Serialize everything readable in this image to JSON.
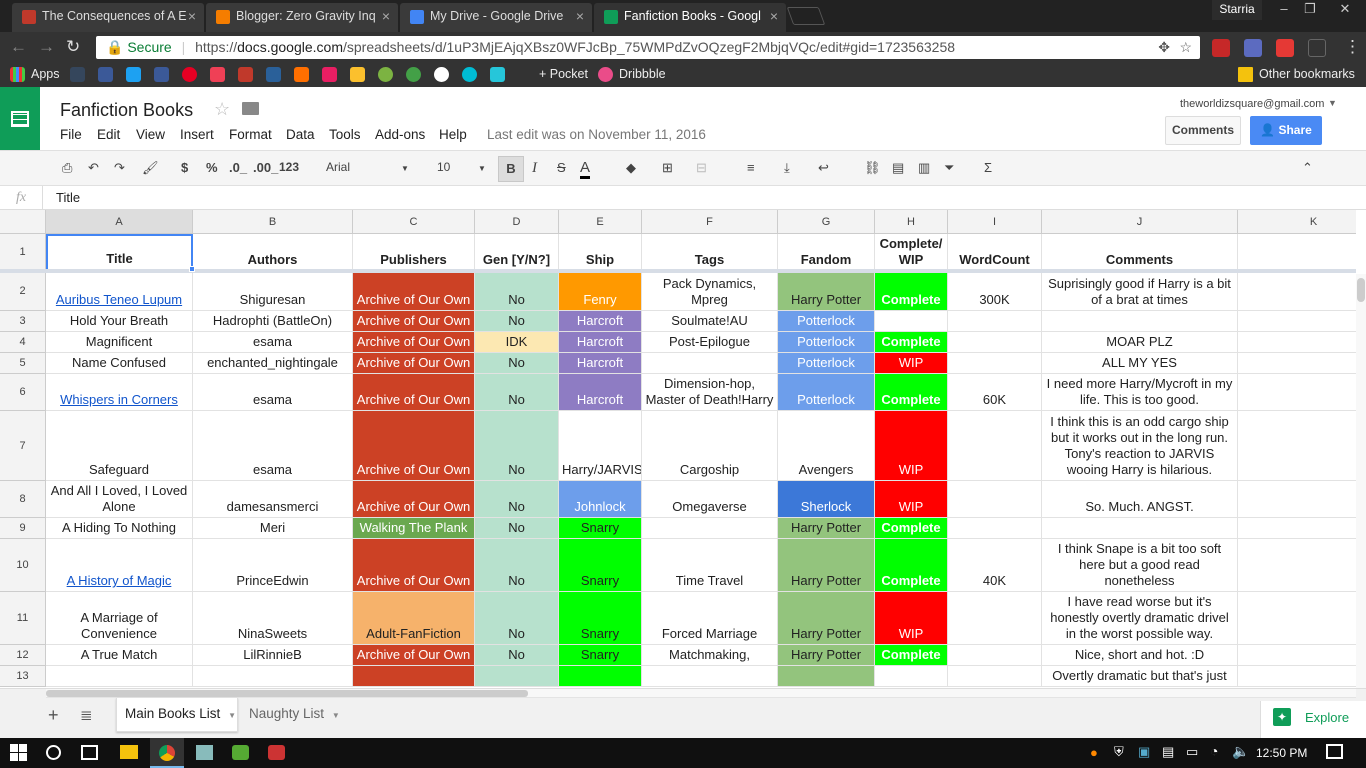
{
  "browser": {
    "tabs": [
      {
        "title": "The Consequences of A E",
        "fav": "#c0392b"
      },
      {
        "title": "Blogger: Zero Gravity Inq",
        "fav": "#f57d00"
      },
      {
        "title": "My Drive - Google Drive",
        "fav": "#4285f4"
      },
      {
        "title": "Fanfiction Books - Googl",
        "fav": "#0f9d58"
      }
    ],
    "profile": "Starria",
    "secure": "Secure",
    "url_prefix": "https://",
    "url_host": "docs.google.com",
    "url_path": "/spreadsheets/d/1uP3MjEAjqXBsz0WFJcBp_75WMPdZvOQzegF2MbjqVQc/edit#gid=1723563258",
    "bookmarks": [
      "Apps",
      "+ Pocket",
      "Dribbble"
    ],
    "other_bookmarks": "Other bookmarks"
  },
  "sheets": {
    "title": "Fanfiction Books",
    "menu": [
      "File",
      "Edit",
      "View",
      "Insert",
      "Format",
      "Data",
      "Tools",
      "Add-ons",
      "Help"
    ],
    "last_edit": "Last edit was on November 11, 2016",
    "account": "theworldizsquare@gmail.com",
    "comments": "Comments",
    "share": "Share",
    "toolbar": {
      "currency": "$",
      "percent": "%",
      "dec0": ".0_",
      "dec00": ".00_",
      "format": "123",
      "font": "Arial",
      "size": "10",
      "bold": "B",
      "italic": "I",
      "strike": "S",
      "color": "A"
    },
    "fx": "fx",
    "formula": "Title",
    "columns": [
      "A",
      "B",
      "C",
      "D",
      "E",
      "F",
      "G",
      "H",
      "I",
      "J",
      "K"
    ],
    "headers": [
      "Title",
      "Authors",
      "Publishers",
      "Gen [Y/N?]",
      "Ship",
      "Tags",
      "Fandom",
      "Complete/ WIP",
      "WordCount",
      "Comments",
      ""
    ],
    "rows": [
      {
        "num": "2",
        "title": "Auribus Teneo Lupum",
        "author": "Shiguresan",
        "pub": "Archive of Our Own",
        "gen": "No",
        "ship": "Fenry",
        "tags": "Pack Dynamics, Mpreg",
        "fandom": "Harry Potter",
        "status": "Complete",
        "wc": "300K",
        "comment": "Suprisingly good if Harry is a bit of a brat at times"
      },
      {
        "num": "3",
        "title": "Hold Your Breath",
        "author": "Hadrophti (BattleOn)",
        "pub": "Archive of Our Own",
        "gen": "No",
        "ship": "Harcroft",
        "tags": "Soulmate!AU",
        "fandom": "Potterlock",
        "status": "",
        "wc": "",
        "comment": ""
      },
      {
        "num": "4",
        "title": "Magnificent",
        "author": "esama",
        "pub": "Archive of Our Own",
        "gen": "IDK",
        "ship": "Harcroft",
        "tags": "Post-Epilogue",
        "fandom": "Potterlock",
        "status": "Complete",
        "wc": "",
        "comment": "MOAR PLZ"
      },
      {
        "num": "5",
        "title": "Name Confused",
        "author": "enchanted_nightingale",
        "pub": "Archive of Our Own",
        "gen": "No",
        "ship": "Harcroft",
        "tags": "",
        "fandom": "Potterlock",
        "status": "WIP",
        "wc": "",
        "comment": "ALL MY YES"
      },
      {
        "num": "6",
        "title": "Whispers in Corners",
        "author": "esama",
        "pub": "Archive of Our Own",
        "gen": "No",
        "ship": "Harcroft",
        "tags": "Dimension-hop, Master of Death!Harry",
        "fandom": "Potterlock",
        "status": "Complete",
        "wc": "60K",
        "comment": "I need more Harry/Mycroft in my life. This is too good."
      },
      {
        "num": "7",
        "title": "Safeguard",
        "author": "esama",
        "pub": "Archive of Our Own",
        "gen": "No",
        "ship": "Harry/JARVIS",
        "tags": "Cargoship",
        "fandom": "Avengers",
        "status": "WIP",
        "wc": "",
        "comment": "I think this is an odd cargo ship but it works out in the long run. Tony's reaction to JARVIS wooing Harry is hilarious."
      },
      {
        "num": "8",
        "title": "And All I Loved, I Loved Alone",
        "author": "damesansmerci",
        "pub": "Archive of Our Own",
        "gen": "No",
        "ship": "Johnlock",
        "tags": "Omegaverse",
        "fandom": "Sherlock",
        "status": "WIP",
        "wc": "",
        "comment": "So. Much. ANGST."
      },
      {
        "num": "9",
        "title": "A Hiding To Nothing",
        "author": "Meri",
        "pub": "Walking The Plank",
        "gen": "No",
        "ship": "Snarry",
        "tags": "",
        "fandom": "Harry Potter",
        "status": "Complete",
        "wc": "",
        "comment": ""
      },
      {
        "num": "10",
        "title": "A History of Magic",
        "author": "PrinceEdwin",
        "pub": "Archive of Our Own",
        "gen": "No",
        "ship": "Snarry",
        "tags": "Time Travel",
        "fandom": "Harry Potter",
        "status": "Complete",
        "wc": "40K",
        "comment": "I think Snape is a bit too soft here but a good read nonetheless"
      },
      {
        "num": "11",
        "title": "A Marriage of Convenience",
        "author": "NinaSweets",
        "pub": "Adult-FanFiction",
        "gen": "No",
        "ship": "Snarry",
        "tags": "Forced Marriage",
        "fandom": "Harry Potter",
        "status": "WIP",
        "wc": "",
        "comment": "I have read worse but it's honestly overtly dramatic drivel in the worst possible way."
      },
      {
        "num": "12",
        "title": "A True Match",
        "author": "LilRinnieB",
        "pub": "Archive of Our Own",
        "gen": "No",
        "ship": "Snarry",
        "tags": "Matchmaking,",
        "fandom": "Harry Potter",
        "status": "Complete",
        "wc": "",
        "comment": "Nice, short and hot. :D"
      },
      {
        "num": "13",
        "title": "",
        "author": "",
        "pub": "",
        "gen": "",
        "ship": "",
        "tags": "",
        "fandom": "",
        "status": "",
        "wc": "",
        "comment": "Overtly dramatic but that's just"
      }
    ],
    "colors": {
      "ao3": "#cc4125",
      "walking": "#6aa84f",
      "adult": "#f6b26b",
      "gen": "#b7e1cd",
      "idk": "#fce8b2",
      "fenry": "#ff9900",
      "harcroft": "#8e7cc3",
      "harryjarvis": "#ffffff",
      "johnlock": "#6d9eeb",
      "snarry": "#00ff00",
      "hp": "#93c47d",
      "potterlock": "#6d9eeb",
      "avengers": "#ffffff",
      "sherlock": "#3c78d8",
      "complete": "#00ff00",
      "wip": "#ff0000"
    },
    "sheet_tabs": [
      "Main Books List",
      "Naughty List"
    ],
    "explore": "Explore"
  },
  "taskbar": {
    "time": "12:50 PM"
  }
}
